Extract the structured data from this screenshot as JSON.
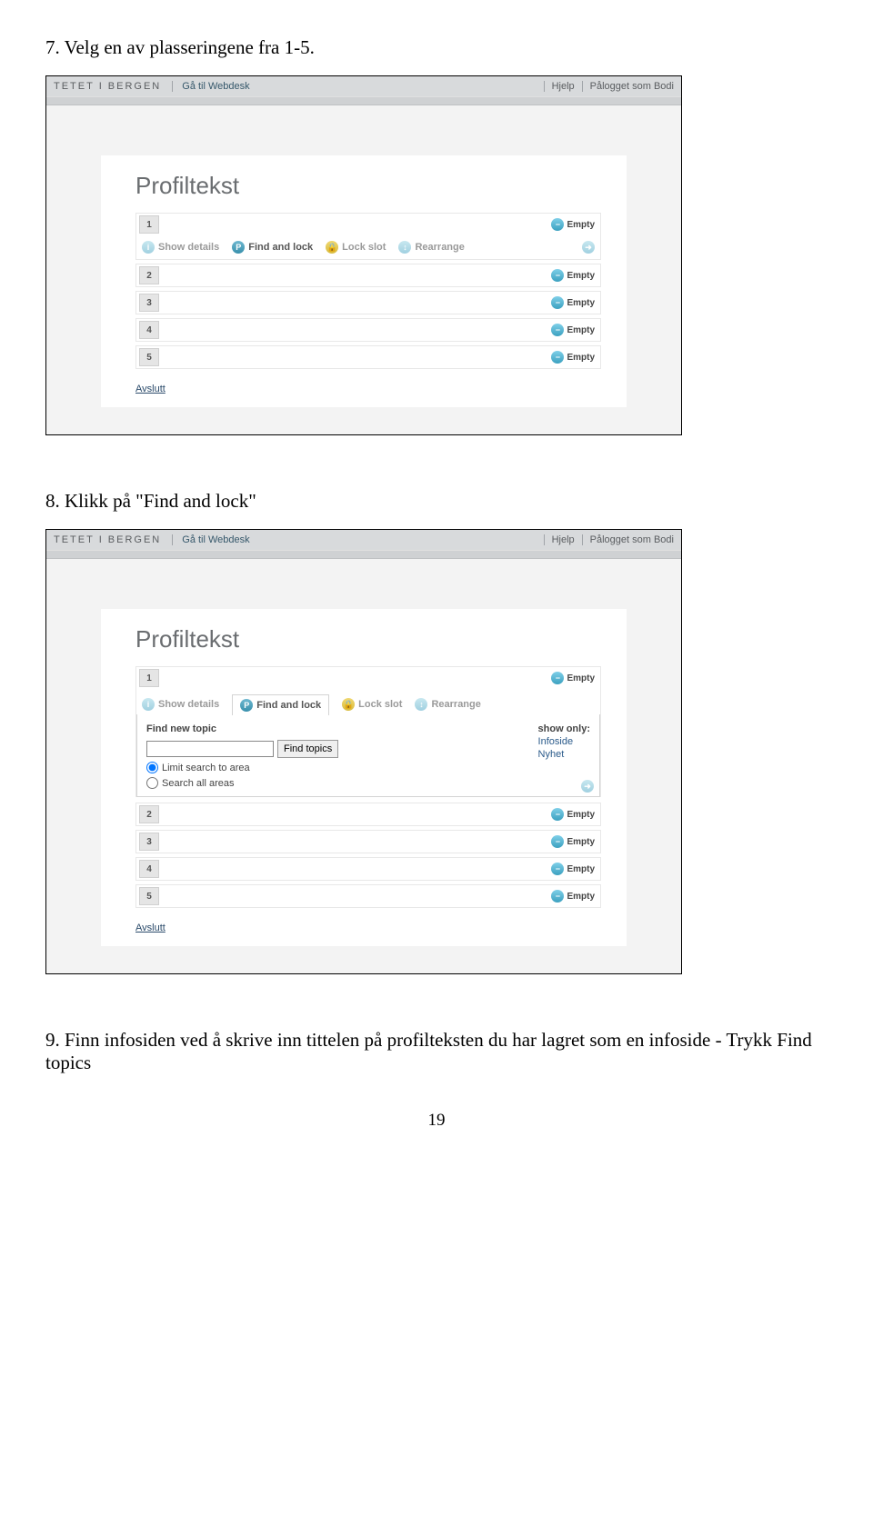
{
  "instr7": "7.  Velg en av plasseringene fra 1-5.",
  "instr8": "8.  Klikk på \"Find and lock\"",
  "instr9": "9.  Finn infosiden ved å skrive inn tittelen på profilteksten du har lagret som en infoside - Trykk Find topics",
  "pageNum": "19",
  "topbar": {
    "brand": "TETET I BERGEN",
    "webdesk": "Gå til Webdesk",
    "help": "Hjelp",
    "logged": "Pålogget som Bodi"
  },
  "panel": {
    "title": "Profiltekst",
    "actions": {
      "showDetails": "Show details",
      "findLock": "Find and lock",
      "lockSlot": "Lock slot",
      "rearrange": "Rearrange"
    },
    "empty": "Empty",
    "slots": [
      "1",
      "2",
      "3",
      "4",
      "5"
    ],
    "avslutt": "Avslutt"
  },
  "find": {
    "newTopic": "Find new topic",
    "findTopicsBtn": "Find topics",
    "limit": "Limit search to area",
    "all": "Search all areas",
    "showOnly": "show only:",
    "infoside": "Infoside",
    "nyhet": "Nyhet"
  }
}
